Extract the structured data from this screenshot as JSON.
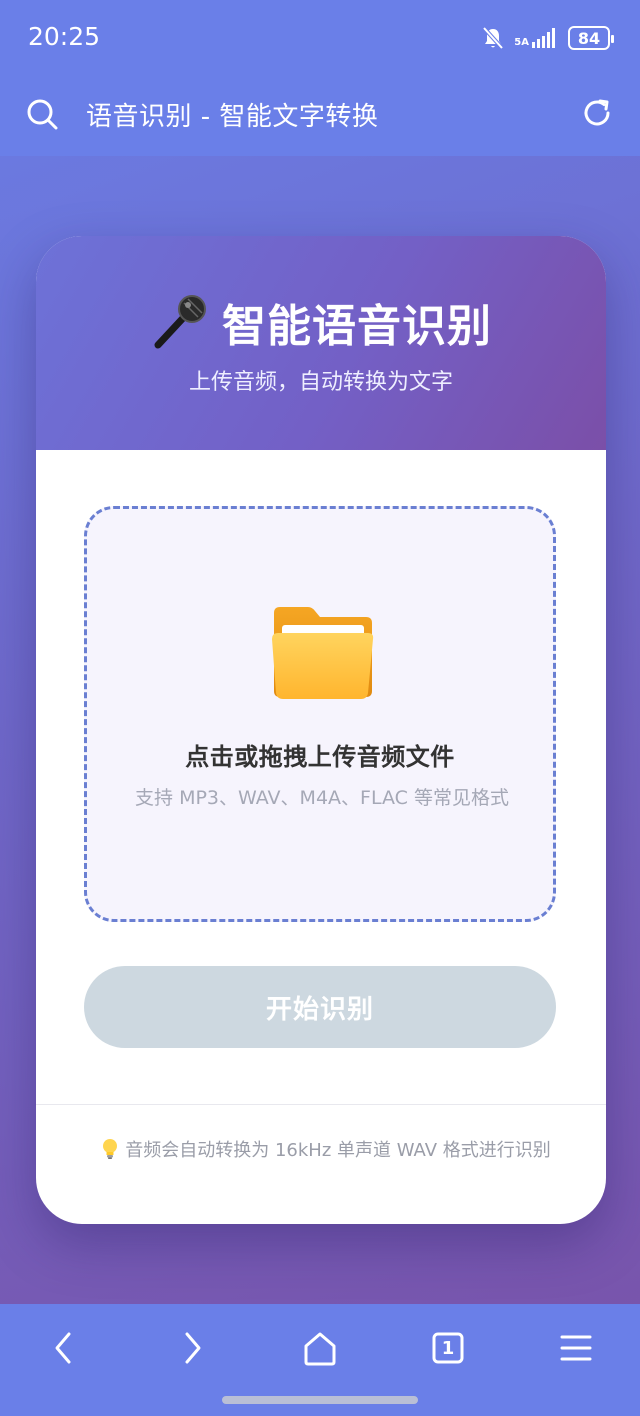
{
  "status_bar": {
    "time": "20:25",
    "network": "5A",
    "battery": "84"
  },
  "browser": {
    "title": "语音识别 - 智能文字转换",
    "tab_count": "1"
  },
  "card": {
    "title": "智能语音识别",
    "subtitle": "上传音频，自动转换为文字",
    "dropzone_title": "点击或拖拽上传音频文件",
    "dropzone_hint": "支持 MP3、WAV、M4A、FLAC 等常见格式",
    "start_button": "开始识别",
    "tip": "音频会自动转换为 16kHz 单声道 WAV 格式进行识别"
  },
  "icons": {
    "search": "search-icon",
    "refresh": "refresh-icon",
    "microphone": "microphone-icon",
    "folder": "folder-icon",
    "bulb": "lightbulb-icon",
    "back": "chevron-left-icon",
    "forward": "chevron-right-icon",
    "home": "home-icon",
    "tabs": "tabs-icon",
    "menu": "menu-icon"
  },
  "colors": {
    "browser_bar": "#6a7fe8",
    "header_start": "#6d72d8",
    "header_end": "#7b4fa8",
    "dropzone_border": "#6a7fd2",
    "button_disabled": "#cdd8e0"
  }
}
